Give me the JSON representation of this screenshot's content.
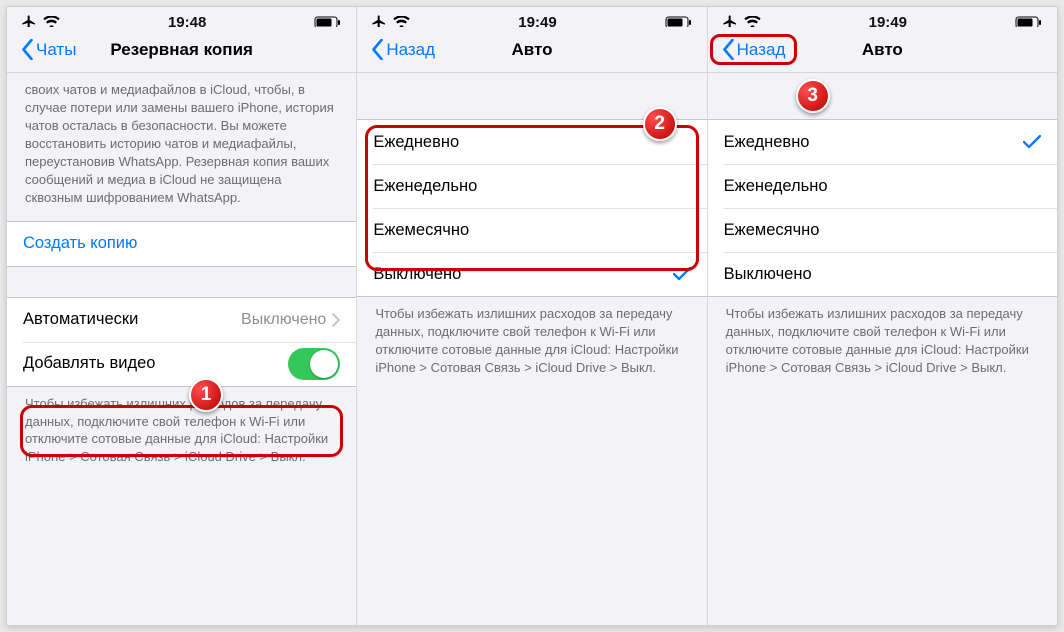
{
  "panels": [
    {
      "status_time": "19:48",
      "nav_back": "Чаты",
      "nav_title": "Резервная копия",
      "desc": "своих чатов и медиафайлов в iCloud, чтобы, в случае потери или замены вашего iPhone, история чатов осталась в безопасности. Вы можете восстановить историю чатов и медиафайлы, переустановив WhatsApp. Резервная копия ваших сообщений и медиа в iCloud не защищена сквозным шифрованием WhatsApp.",
      "create": "Создать копию",
      "auto_label": "Автоматически",
      "auto_value": "Выключено",
      "video_label": "Добавлять видео",
      "footer": "Чтобы избежать излишних расходов за передачу данных, подключите свой телефон к Wi-Fi или отключите сотовые данные для iCloud: Настройки iPhone > Сотовая Связь > iCloud Drive > Выкл.",
      "marker": "1"
    },
    {
      "status_time": "19:49",
      "nav_back": "Назад",
      "nav_title": "Авто",
      "options": [
        "Ежедневно",
        "Еженедельно",
        "Ежемесячно"
      ],
      "off": "Выключено",
      "selected": 3,
      "footer": "Чтобы избежать излишних расходов за передачу данных, подключите свой телефон к Wi-Fi или отключите сотовые данные для iCloud: Настройки iPhone > Сотовая Связь > iCloud Drive > Выкл.",
      "marker": "2"
    },
    {
      "status_time": "19:49",
      "nav_back": "Назад",
      "nav_title": "Авто",
      "options": [
        "Ежедневно",
        "Еженедельно",
        "Ежемесячно"
      ],
      "off": "Выключено",
      "selected": 0,
      "footer": "Чтобы избежать излишних расходов за передачу данных, подключите свой телефон к Wi-Fi или отключите сотовые данные для iCloud: Настройки iPhone > Сотовая Связь > iCloud Drive > Выкл.",
      "marker": "3"
    }
  ],
  "colors": {
    "ios_blue": "#007aff",
    "callout_red": "#cc0000",
    "ios_green": "#35c759"
  }
}
